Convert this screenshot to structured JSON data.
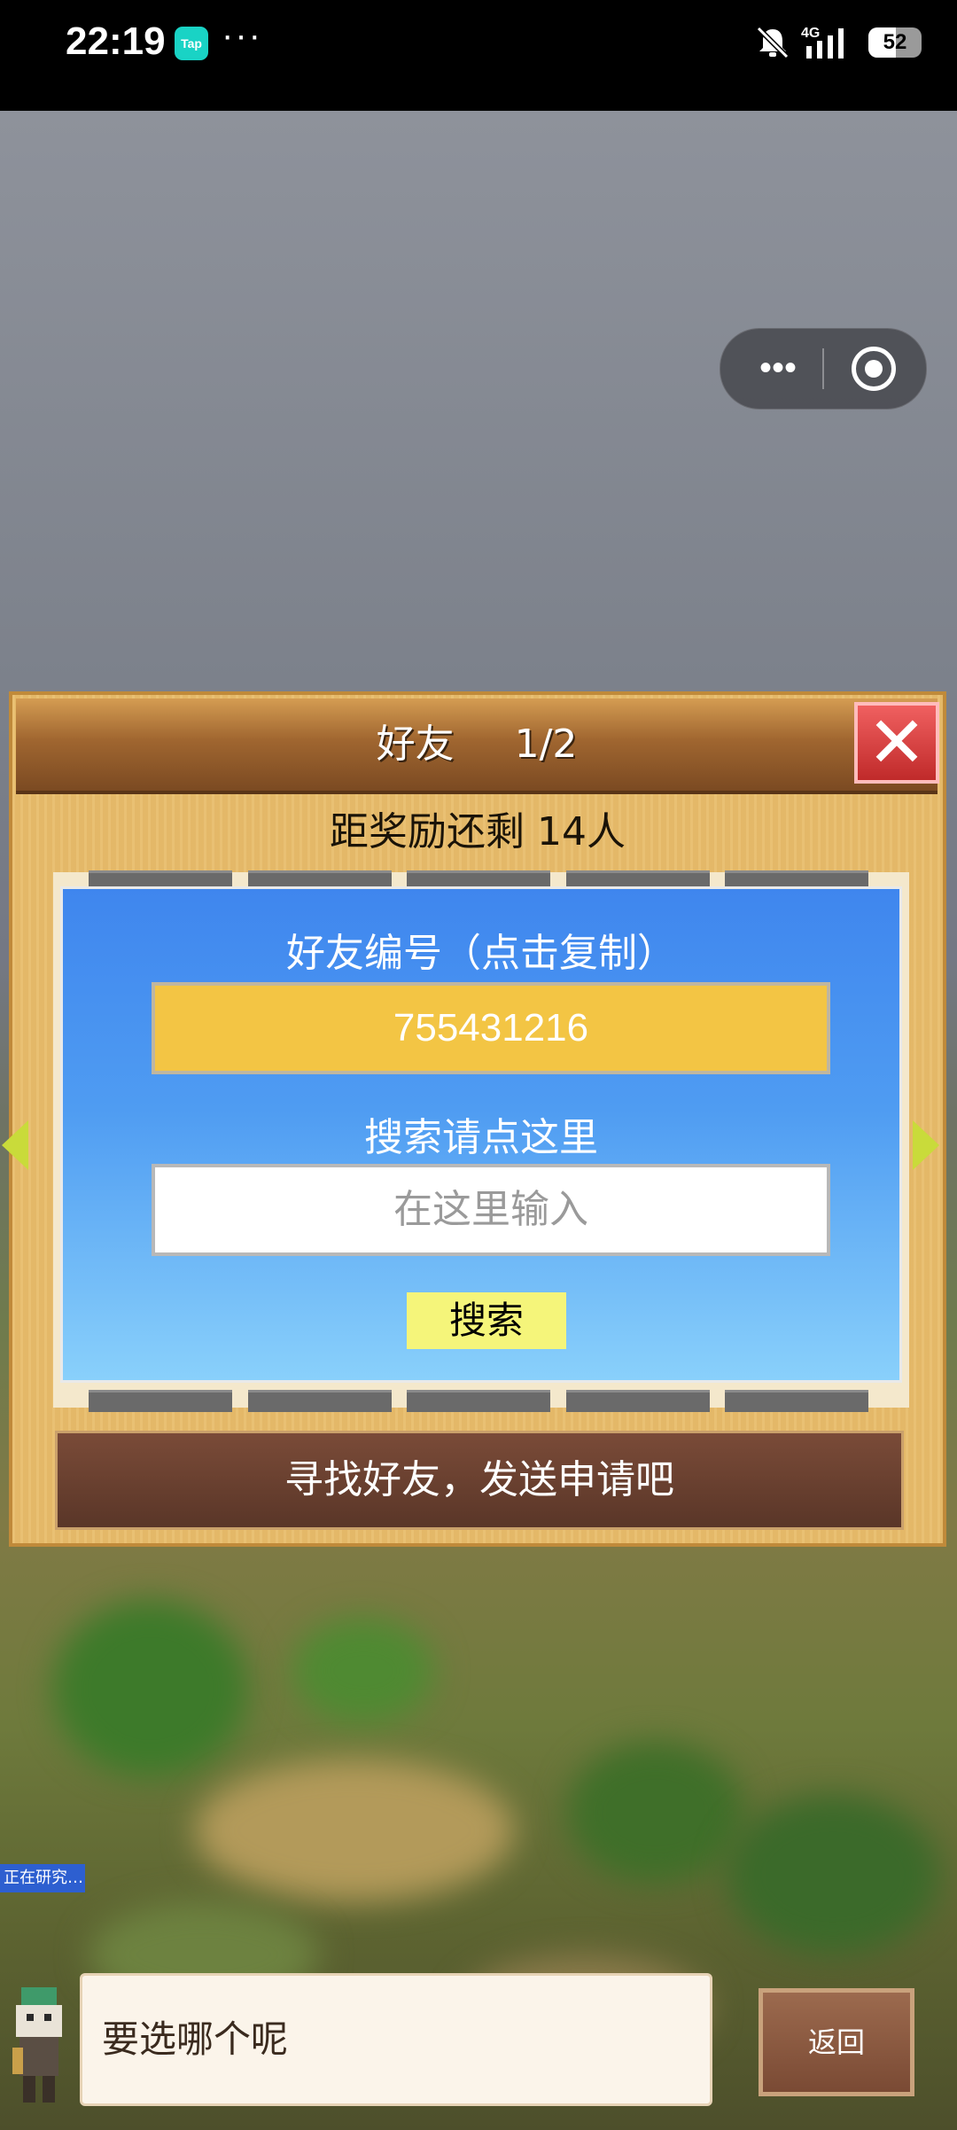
{
  "status_bar": {
    "time": "22:19",
    "app_badge": "Tap",
    "more_dots": "···",
    "network": "4G",
    "battery": "52",
    "icons": [
      "mute-bell-icon",
      "signal-icon",
      "battery-icon"
    ]
  },
  "miniprogram_capsule": {
    "more_label": "•••",
    "icons": [
      "more-icon",
      "close-target-icon"
    ]
  },
  "dialog": {
    "title": "好友",
    "page": "1/2",
    "close_symbol": "✕",
    "reward_text": "距奖励还剩 14人",
    "friend_id_label": "好友编号（点击复制）",
    "friend_id_value": "755431216",
    "search_label": "搜索请点这里",
    "search_placeholder": "在这里输入",
    "search_button": "搜索",
    "action_button": "寻找好友，发送申请吧"
  },
  "game": {
    "researching_tag": "正在研究…",
    "dialogue_text": "要选哪个呢",
    "back_button": "返回"
  },
  "colors": {
    "panel_blue": "#3f86ee",
    "id_box_yellow": "#f3c544",
    "search_button_yellow": "#f5f57a",
    "close_red": "#e04848",
    "header_brown": "#7b4a22",
    "action_brown": "#6a4030"
  }
}
